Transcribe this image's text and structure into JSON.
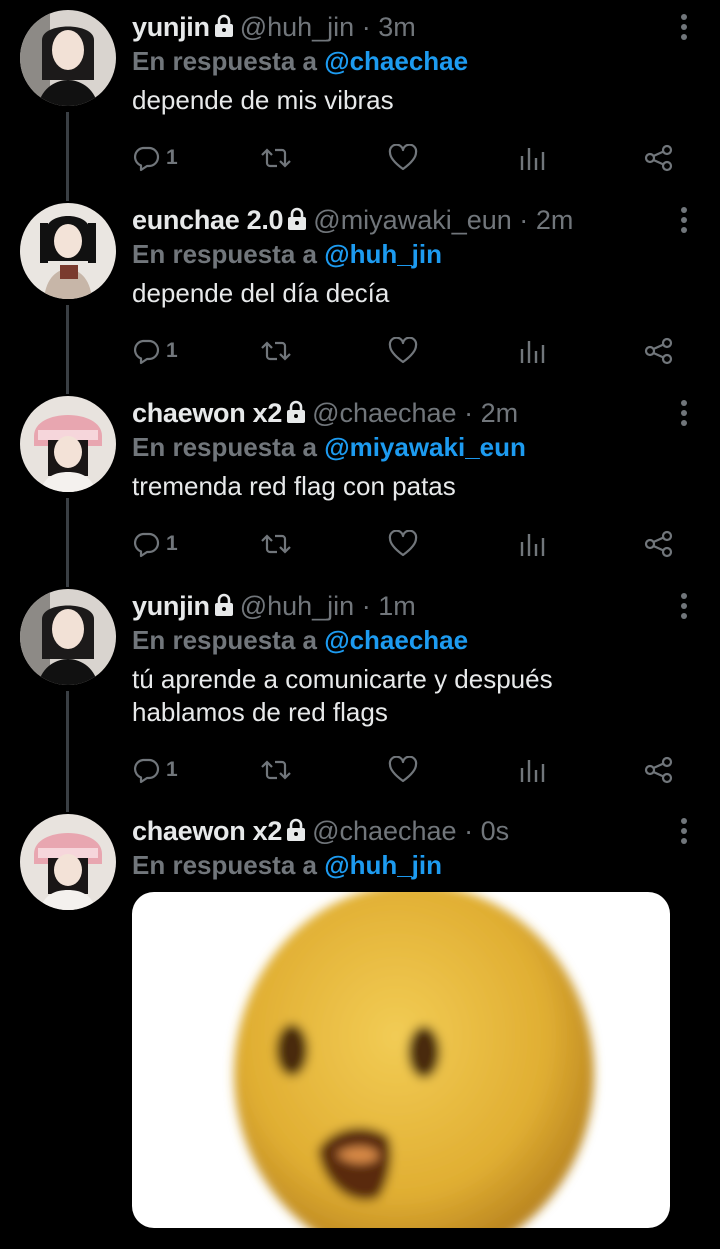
{
  "icons": {
    "lock": "lock-icon",
    "reply": "reply-icon",
    "retweet": "retweet-icon",
    "like": "heart-icon",
    "views": "views-icon",
    "share": "share-icon",
    "more": "more-icon"
  },
  "colors": {
    "background": "#000000",
    "text": "#e7e9ea",
    "muted": "#71767b",
    "mention": "#1d9bf0",
    "emoji": "#e6b63a"
  },
  "reply_prefix": "En respuesta a",
  "tweets": [
    {
      "name": "yunjin",
      "handle": "@huh_jin",
      "separator": "·",
      "time": "3m",
      "reply_to": "@chaechae",
      "text_lines": [
        "depende de mis vibras"
      ],
      "replies": "1"
    },
    {
      "name": "eunchae 2.0",
      "handle": "@miyawaki_eun",
      "separator": "·",
      "time": "2m",
      "reply_to": "@huh_jin",
      "text_lines": [
        "depende del día decía"
      ],
      "replies": "1"
    },
    {
      "name": "chaewon x2",
      "handle": "@chaechae",
      "separator": "·",
      "time": "2m",
      "reply_to": "@miyawaki_eun",
      "text_lines": [
        "tremenda red flag con patas"
      ],
      "replies": "1"
    },
    {
      "name": "yunjin",
      "handle": "@huh_jin",
      "separator": "·",
      "time": "1m",
      "reply_to": "@chaechae",
      "text_lines": [
        "tú aprende a comunicarte y después",
        "hablamos de red flags"
      ],
      "replies": "1"
    },
    {
      "name": "chaewon x2",
      "handle": "@chaechae",
      "separator": "·",
      "time": "0s",
      "reply_to": "@huh_jin",
      "media": "shocked-emoji-image"
    }
  ]
}
